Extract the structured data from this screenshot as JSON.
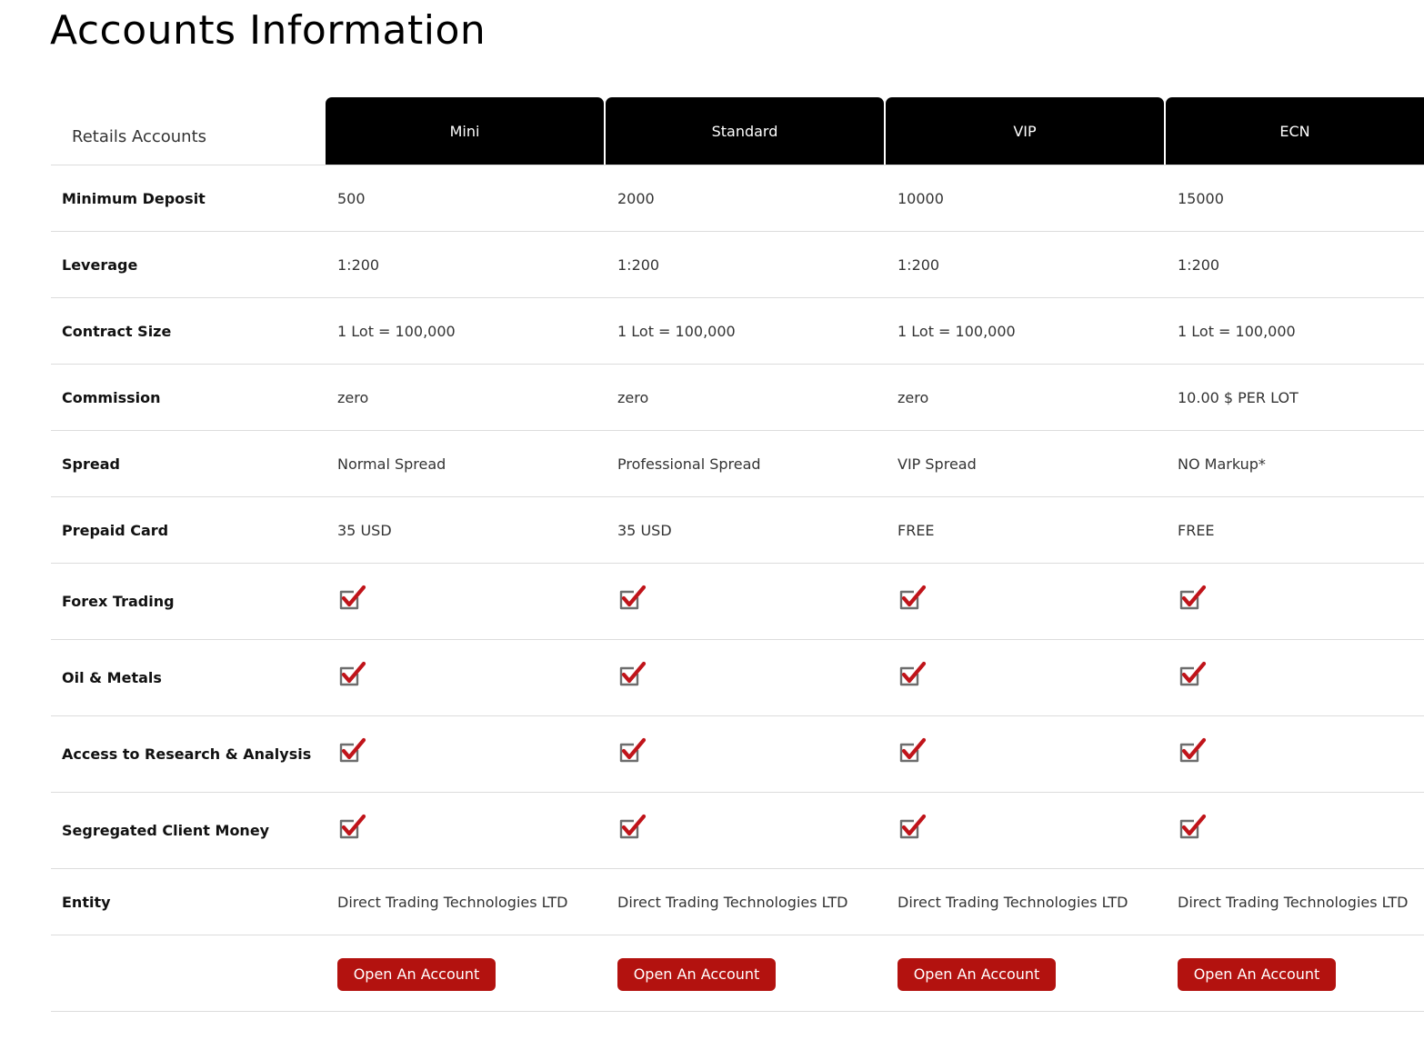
{
  "page": {
    "title": "Accounts Information"
  },
  "table": {
    "corner_label": "Retails Accounts",
    "columns": [
      "Mini",
      "Standard",
      "VIP",
      "ECN"
    ],
    "rows": [
      {
        "label": "Minimum Deposit",
        "values": [
          "500",
          "2000",
          "10000",
          "15000"
        ]
      },
      {
        "label": "Leverage",
        "values": [
          "1:200",
          "1:200",
          "1:200",
          "1:200"
        ]
      },
      {
        "label": "Contract Size",
        "values": [
          "1 Lot = 100,000",
          "1 Lot = 100,000",
          "1 Lot = 100,000",
          "1 Lot = 100,000"
        ]
      },
      {
        "label": "Commission",
        "values": [
          "zero",
          "zero",
          "zero",
          "10.00 $ PER LOT"
        ]
      },
      {
        "label": "Spread",
        "values": [
          "Normal Spread",
          "Professional Spread",
          "VIP Spread",
          "NO Markup*"
        ]
      },
      {
        "label": "Prepaid Card",
        "values": [
          "35 USD",
          "35 USD",
          "FREE",
          "FREE"
        ]
      }
    ],
    "check_rows": [
      {
        "label": "Forex Trading",
        "values": [
          true,
          true,
          true,
          true
        ]
      },
      {
        "label": "Oil & Metals",
        "values": [
          true,
          true,
          true,
          true
        ]
      },
      {
        "label": "Access to Research & Analysis",
        "values": [
          true,
          true,
          true,
          true
        ]
      },
      {
        "label": "Segregated Client Money",
        "values": [
          true,
          true,
          true,
          true
        ]
      }
    ],
    "entity_row": {
      "label": "Entity",
      "values": [
        "Direct Trading Technologies LTD",
        "Direct Trading Technologies LTD",
        "Direct Trading Technologies LTD",
        "Direct Trading Technologies LTD"
      ]
    },
    "button_label": "Open An Account"
  },
  "icons": {
    "check": "checkbox-checked-icon"
  },
  "colors": {
    "header_bg": "#000000",
    "header_text": "#ffffff",
    "button_bg": "#b3120f",
    "check_red": "#c0141a",
    "box_gray": "#6d6d6d"
  }
}
